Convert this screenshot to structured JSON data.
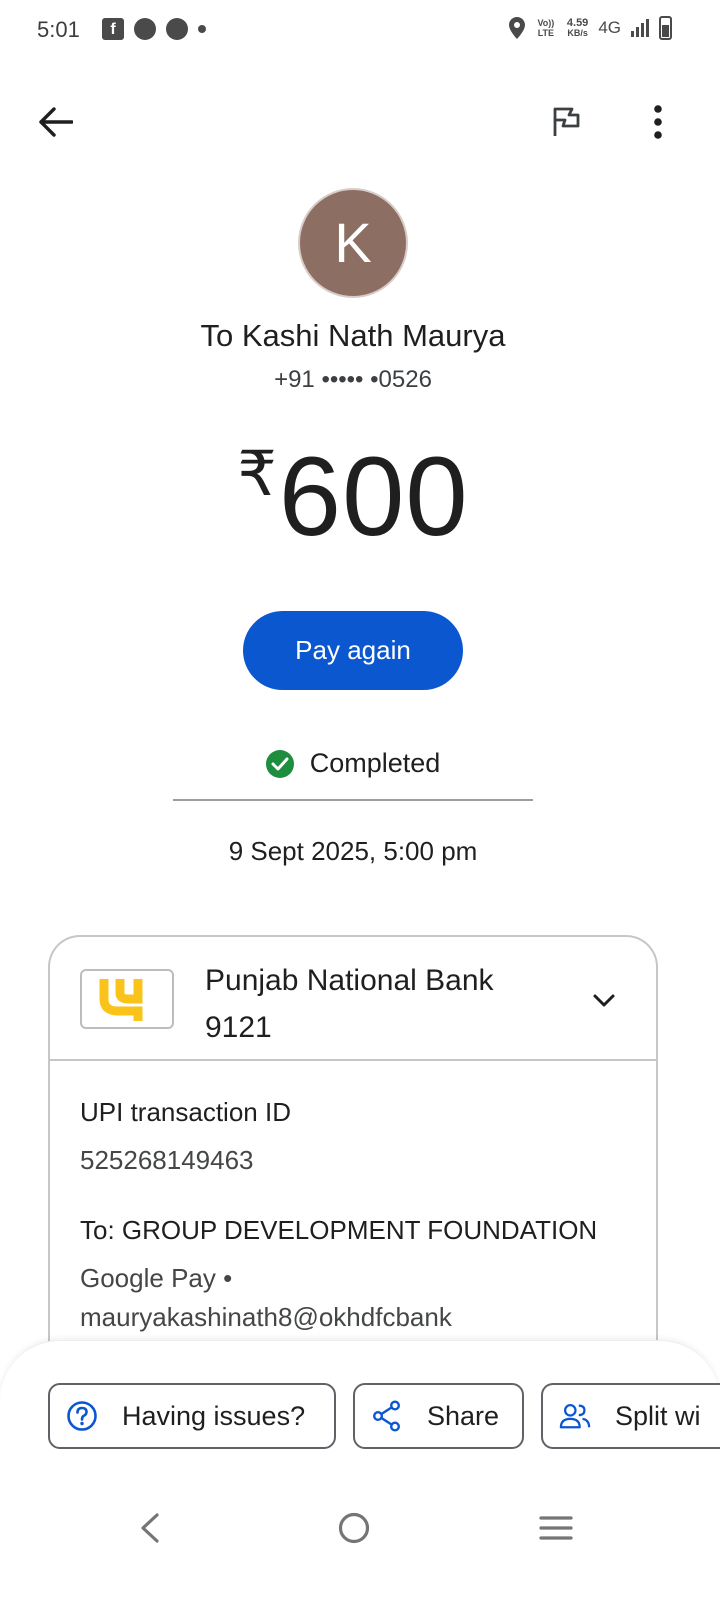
{
  "status_bar": {
    "time": "5:01",
    "volte_label": "Vo)) LTE",
    "speed_value": "4.59",
    "speed_unit": "KB/s",
    "network": "4G"
  },
  "payee": {
    "avatar_letter": "K",
    "name": "To Kashi Nath Maurya",
    "phone": "+91 ••••• •0526"
  },
  "payment": {
    "currency_symbol": "₹",
    "amount": "600",
    "pay_again_label": "Pay again",
    "status": "Completed",
    "datetime": "9 Sept 2025, 5:00 pm"
  },
  "account": {
    "bank_name": "Punjab National Bank 9121",
    "upi_id_label": "UPI transaction ID",
    "upi_id_value": "525268149463",
    "to_label": "To: GROUP DEVELOPMENT FOUNDATION",
    "to_line1": "Google Pay •",
    "to_line2": "mauryakashinath8@okhdfcbank"
  },
  "actions": {
    "issues_label": "Having issues?",
    "share_label": "Share",
    "split_label": "Split wi"
  },
  "colors": {
    "primary": "#0b57d0",
    "success": "#1e8e3e",
    "avatar": "#8d6e63",
    "bank_logo_yellow": "#f9c31a"
  },
  "icons": {
    "back": "arrow-left-icon",
    "report": "flag-icon",
    "more": "more-vert-icon",
    "status": "check-circle-icon",
    "expand": "chevron-down-icon",
    "issues": "help-icon",
    "share": "share-icon",
    "split": "group-icon"
  }
}
